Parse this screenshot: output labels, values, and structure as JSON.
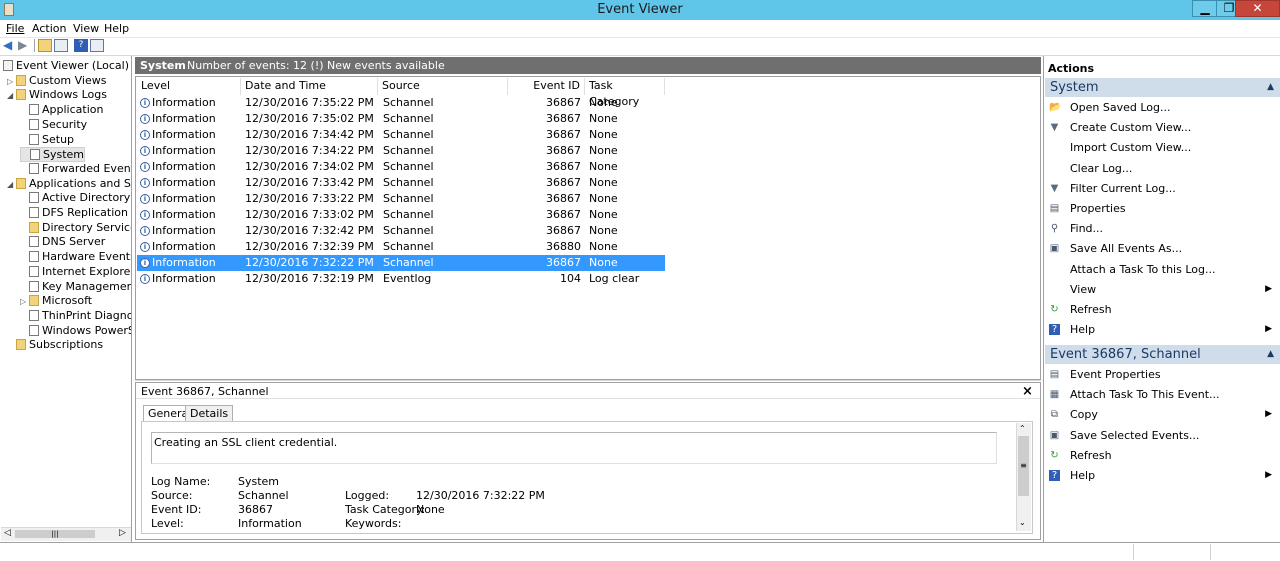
{
  "window": {
    "title": "Event Viewer"
  },
  "menu": {
    "file": "File",
    "action": "Action",
    "view": "View",
    "help": "Help"
  },
  "tree": [
    {
      "label": "Event Viewer (Local)",
      "indent": 0,
      "twisty": ""
    },
    {
      "label": "Custom Views",
      "indent": 1,
      "twisty": "▷"
    },
    {
      "label": "Windows Logs",
      "indent": 1,
      "twisty": "◢"
    },
    {
      "label": "Application",
      "indent": 2,
      "twisty": ""
    },
    {
      "label": "Security",
      "indent": 2,
      "twisty": ""
    },
    {
      "label": "Setup",
      "indent": 2,
      "twisty": ""
    },
    {
      "label": "System",
      "indent": 2,
      "twisty": "",
      "selected": true
    },
    {
      "label": "Forwarded Events",
      "indent": 2,
      "twisty": ""
    },
    {
      "label": "Applications and Servi",
      "indent": 1,
      "twisty": "◢"
    },
    {
      "label": "Active Directory We",
      "indent": 2,
      "twisty": ""
    },
    {
      "label": "DFS Replication",
      "indent": 2,
      "twisty": ""
    },
    {
      "label": "Directory Service",
      "indent": 2,
      "twisty": ""
    },
    {
      "label": "DNS Server",
      "indent": 2,
      "twisty": ""
    },
    {
      "label": "Hardware Events",
      "indent": 2,
      "twisty": ""
    },
    {
      "label": "Internet Explorer",
      "indent": 2,
      "twisty": ""
    },
    {
      "label": "Key Management Se",
      "indent": 2,
      "twisty": ""
    },
    {
      "label": "Microsoft",
      "indent": 2,
      "twisty": "▷"
    },
    {
      "label": "ThinPrint Diagnostic",
      "indent": 2,
      "twisty": ""
    },
    {
      "label": "Windows PowerShe",
      "indent": 2,
      "twisty": ""
    },
    {
      "label": "Subscriptions",
      "indent": 1,
      "twisty": ""
    }
  ],
  "center": {
    "log_name": "System",
    "summary": "Number of events: 12 (!) New events available",
    "columns": [
      "Level",
      "Date and Time",
      "Source",
      "Event ID",
      "Task Category"
    ],
    "rows": [
      {
        "level": "Information",
        "datetime": "12/30/2016 7:35:22 PM",
        "source": "Schannel",
        "event_id": "36867",
        "category": "None"
      },
      {
        "level": "Information",
        "datetime": "12/30/2016 7:35:02 PM",
        "source": "Schannel",
        "event_id": "36867",
        "category": "None"
      },
      {
        "level": "Information",
        "datetime": "12/30/2016 7:34:42 PM",
        "source": "Schannel",
        "event_id": "36867",
        "category": "None"
      },
      {
        "level": "Information",
        "datetime": "12/30/2016 7:34:22 PM",
        "source": "Schannel",
        "event_id": "36867",
        "category": "None"
      },
      {
        "level": "Information",
        "datetime": "12/30/2016 7:34:02 PM",
        "source": "Schannel",
        "event_id": "36867",
        "category": "None"
      },
      {
        "level": "Information",
        "datetime": "12/30/2016 7:33:42 PM",
        "source": "Schannel",
        "event_id": "36867",
        "category": "None"
      },
      {
        "level": "Information",
        "datetime": "12/30/2016 7:33:22 PM",
        "source": "Schannel",
        "event_id": "36867",
        "category": "None"
      },
      {
        "level": "Information",
        "datetime": "12/30/2016 7:33:02 PM",
        "source": "Schannel",
        "event_id": "36867",
        "category": "None"
      },
      {
        "level": "Information",
        "datetime": "12/30/2016 7:32:42 PM",
        "source": "Schannel",
        "event_id": "36867",
        "category": "None"
      },
      {
        "level": "Information",
        "datetime": "12/30/2016 7:32:39 PM",
        "source": "Schannel",
        "event_id": "36880",
        "category": "None"
      },
      {
        "level": "Information",
        "datetime": "12/30/2016 7:32:22 PM",
        "source": "Schannel",
        "event_id": "36867",
        "category": "None",
        "selected": true
      },
      {
        "level": "Information",
        "datetime": "12/30/2016 7:32:19 PM",
        "source": "Eventlog",
        "event_id": "104",
        "category": "Log clear"
      }
    ]
  },
  "detail": {
    "title": "Event 36867, Schannel",
    "close": "×",
    "tabs": [
      "General",
      "Details"
    ],
    "description": "Creating an SSL client credential.",
    "labels": {
      "log_name": "Log Name:",
      "source": "Source:",
      "event_id": "Event ID:",
      "level": "Level:",
      "logged": "Logged:",
      "task_category": "Task Category:",
      "keywords": "Keywords:"
    },
    "values": {
      "log_name": "System",
      "source": "Schannel",
      "event_id": "36867",
      "level": "Information",
      "logged": "12/30/2016 7:32:22 PM",
      "task_category": "None",
      "keywords": ""
    }
  },
  "actions": {
    "header": "Actions",
    "section1": "System",
    "section1_items": [
      {
        "label": "Open Saved Log...",
        "icon": "folder-open-icon",
        "glyph": "📂",
        "submenu": false
      },
      {
        "label": "Create Custom View...",
        "icon": "filter-icon",
        "glyph": "▼",
        "submenu": false
      },
      {
        "label": "Import Custom View...",
        "icon": "",
        "glyph": "",
        "submenu": false
      },
      {
        "label": "Clear Log...",
        "icon": "",
        "glyph": "",
        "submenu": false
      },
      {
        "label": "Filter Current Log...",
        "icon": "filter-icon",
        "glyph": "▼",
        "submenu": false
      },
      {
        "label": "Properties",
        "icon": "properties-icon",
        "glyph": "▤",
        "submenu": false
      },
      {
        "label": "Find...",
        "icon": "binoculars-icon",
        "glyph": "⚲",
        "submenu": false
      },
      {
        "label": "Save All Events As...",
        "icon": "save-icon",
        "glyph": "▣",
        "submenu": false
      },
      {
        "label": "Attach a Task To this Log...",
        "icon": "",
        "glyph": "",
        "submenu": false
      },
      {
        "label": "View",
        "icon": "",
        "glyph": "",
        "submenu": true
      },
      {
        "label": "Refresh",
        "icon": "refresh-icon",
        "glyph": "↻",
        "submenu": false
      },
      {
        "label": "Help",
        "icon": "help-icon",
        "glyph": "?",
        "submenu": true
      }
    ],
    "section2": "Event 36867, Schannel",
    "section2_items": [
      {
        "label": "Event Properties",
        "icon": "properties-icon",
        "glyph": "▤",
        "submenu": false
      },
      {
        "label": "Attach Task To This Event...",
        "icon": "task-icon",
        "glyph": "▦",
        "submenu": false
      },
      {
        "label": "Copy",
        "icon": "copy-icon",
        "glyph": "⧉",
        "submenu": true
      },
      {
        "label": "Save Selected Events...",
        "icon": "save-icon",
        "glyph": "▣",
        "submenu": false
      },
      {
        "label": "Refresh",
        "icon": "refresh-icon",
        "glyph": "↻",
        "submenu": false
      },
      {
        "label": "Help",
        "icon": "help-icon",
        "glyph": "?",
        "submenu": true
      }
    ]
  }
}
